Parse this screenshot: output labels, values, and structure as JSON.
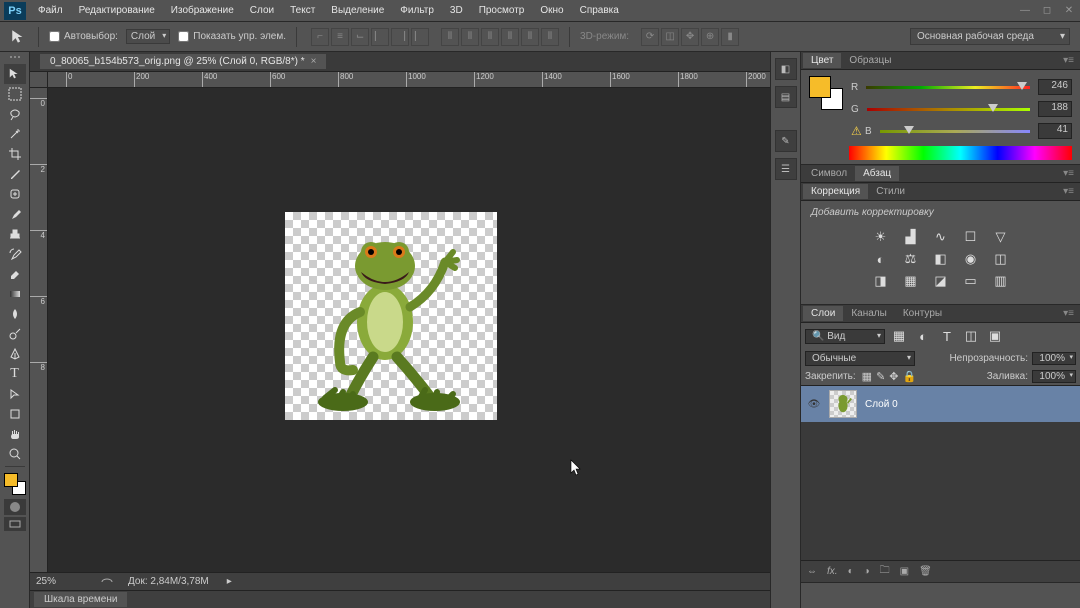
{
  "menubar": [
    "Файл",
    "Редактирование",
    "Изображение",
    "Слои",
    "Текст",
    "Выделение",
    "Фильтр",
    "3D",
    "Просмотр",
    "Окно",
    "Справка"
  ],
  "optbar": {
    "autoselect": "Автовыбор:",
    "autoselect_val": "Слой",
    "showctrl": "Показать упр. элем.",
    "d3": "3D-режим:"
  },
  "workspace": "Основная рабочая среда",
  "doc_tab": "0_80065_b154b573_orig.png @ 25% (Слой 0, RGB/8*) *",
  "ruler_h": [
    "0",
    "200",
    "400",
    "600",
    "800",
    "1000",
    "1200",
    "1400",
    "1600",
    "1800",
    "2000"
  ],
  "ruler_v": [
    "0",
    "2",
    "4",
    "6",
    "8"
  ],
  "status": {
    "zoom": "25%",
    "doc": "Док: 2,84M/3,78M"
  },
  "timeline_tab": "Шкала времени",
  "color_panel": {
    "tab1": "Цвет",
    "tab2": "Образцы",
    "r_label": "R",
    "g_label": "G",
    "b_label": "B",
    "r": "246",
    "g": "188",
    "b": "41"
  },
  "char_panel": {
    "tab1": "Символ",
    "tab2": "Абзац"
  },
  "adj_panel": {
    "tab1": "Коррекция",
    "tab2": "Стили",
    "title": "Добавить корректировку"
  },
  "layers_panel": {
    "tab1": "Слои",
    "tab2": "Каналы",
    "tab3": "Контуры",
    "filter": "Вид",
    "blend": "Обычные",
    "opacity_label": "Непрозрачность:",
    "opacity": "100%",
    "lock_label": "Закрепить:",
    "fill_label": "Заливка:",
    "fill": "100%",
    "layer0": "Слой 0"
  }
}
